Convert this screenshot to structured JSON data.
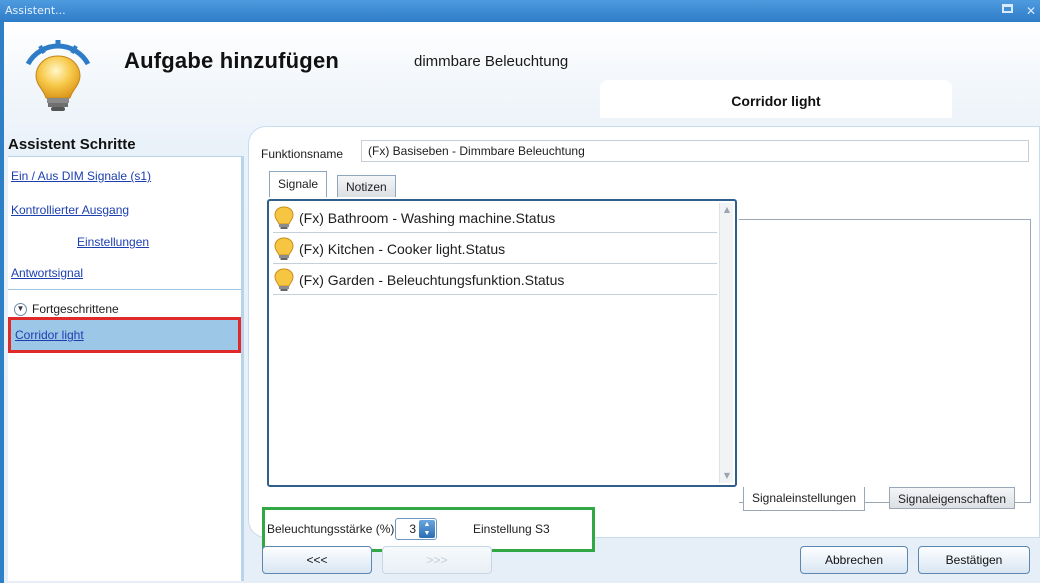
{
  "window": {
    "title": "Assistent..."
  },
  "header": {
    "title": "Aufgabe hinzufügen",
    "subtitle": "dimmbare Beleuchtung",
    "device_tab": "Corridor light"
  },
  "sidebar": {
    "title": "Assistent Schritte",
    "steps": [
      {
        "label": "Ein / Aus DIM Signale (s1)"
      },
      {
        "label": "Kontrollierter Ausgang"
      },
      {
        "label": "Einstellungen"
      },
      {
        "label": "Antwortsignal"
      }
    ],
    "advanced_label": "Fortgeschrittene",
    "active_step": "Corridor light"
  },
  "main": {
    "function_name_label": "Funktionsname",
    "function_name_value": "(Fx) Basiseben - Dimmbare Beleuchtung",
    "tabs": [
      {
        "label": "Signale"
      },
      {
        "label": "Notizen"
      }
    ],
    "signals": [
      {
        "label": "(Fx) Bathroom - Washing machine.Status",
        "icon": "lightbulb-icon"
      },
      {
        "label": "(Fx) Kitchen - Cooker light.Status",
        "icon": "lightbulb-icon"
      },
      {
        "label": "(Fx) Garden - Beleuchtungsfunktion.Status",
        "icon": "lightbulb-icon"
      }
    ],
    "signal_tabs": [
      {
        "label": "Signaleinstellungen"
      },
      {
        "label": "Signaleigenschaften"
      }
    ],
    "brightness": {
      "label": "Beleuchtungsstärke (%)",
      "value": "3",
      "setting": "Einstellung S3"
    }
  },
  "footer": {
    "back": "<<<",
    "next": ">>>",
    "cancel": "Abbrechen",
    "confirm": "Bestätigen"
  },
  "colors": {
    "titlebar": "#2e7cc7",
    "highlight_red": "#e02a2a",
    "highlight_green": "#31a843",
    "active_step_bg": "#9dc7e6",
    "link": "#1c3fb0"
  }
}
